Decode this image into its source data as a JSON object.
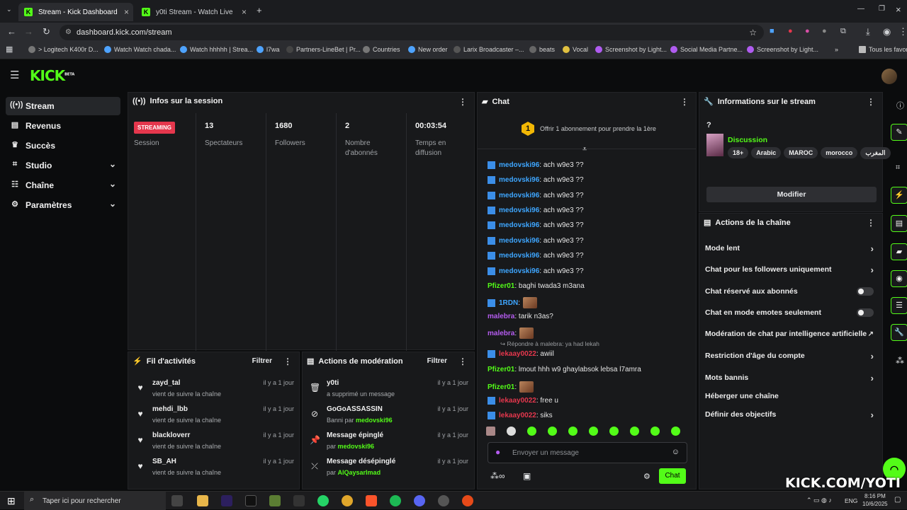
{
  "browser": {
    "tabs": [
      {
        "label": "Stream - Kick Dashboard"
      },
      {
        "label": "y0ti Stream - Watch Live on Kick"
      }
    ],
    "url": "dashboard.kick.com/stream",
    "bookmarks": [
      "> Logitech K400r D...",
      "Watch Watch chada...",
      "Watch hhhhh | Strea...",
      "l7wa",
      "Partners-LineBet | Pr...",
      "Countries",
      "New order",
      "Larix Broadcaster –...",
      "beats",
      "Vocal",
      "Screenshot by Light...",
      "Social Media Partne...",
      "Screenshot by Light...",
      "Tous les favoris"
    ]
  },
  "app": {
    "logo": "KICK",
    "logo_beta": "BETA"
  },
  "sidebar": {
    "items": [
      {
        "label": "Stream",
        "icon": "radio-icon"
      },
      {
        "label": "Revenus",
        "icon": "chart-icon"
      },
      {
        "label": "Succès",
        "icon": "trophy-icon"
      },
      {
        "label": "Studio",
        "icon": "studio-icon"
      },
      {
        "label": "Chaîne",
        "icon": "channel-icon"
      },
      {
        "label": "Paramètres",
        "icon": "gear-icon"
      }
    ]
  },
  "session": {
    "title": "Infos sur la session",
    "badge": "STREAMING",
    "session_label": "Session",
    "stats": [
      {
        "value": "13",
        "label": "Spectateurs"
      },
      {
        "value": "1680",
        "label": "Followers"
      },
      {
        "value": "2",
        "label": "Nombre d'abonnés"
      },
      {
        "value": "00:03:54",
        "label": "Temps en diffusion"
      }
    ]
  },
  "feed": {
    "title": "Fil d'activités",
    "filter": "Filtrer",
    "items": [
      {
        "name": "zayd_tal",
        "sub": "vient de suivre la chaîne",
        "time": "il y a 1 jour"
      },
      {
        "name": "mehdi_lbb",
        "sub": "vient de suivre la chaîne",
        "time": "il y a 1 jour"
      },
      {
        "name": "blackloverr",
        "sub": "vient de suivre la chaîne",
        "time": "il y a 1 jour"
      },
      {
        "name": "SB_AH",
        "sub": "vient de suivre la chaîne",
        "time": "il y a 1 jour"
      }
    ]
  },
  "modactions": {
    "title": "Actions de modération",
    "filter": "Filtrer",
    "items": [
      {
        "name": "y0ti",
        "sub": "a supprimé un message",
        "target": "",
        "time": "il y a 1 jour",
        "icon": "trash-icon"
      },
      {
        "name": "GoGoASSASSIN",
        "sub": "Banni par",
        "target": "medovski96",
        "time": "il y a 1 jour",
        "icon": "ban-icon"
      },
      {
        "name": "Message épinglé",
        "sub": "par",
        "target": "medovski96",
        "time": "il y a 1 jour",
        "icon": "pin-icon"
      },
      {
        "name": "Message désépinglé",
        "sub": "par",
        "target": "AlQaysarImad",
        "time": "il y a 1 jour",
        "icon": "unpin-icon"
      }
    ]
  },
  "chat": {
    "title": "Chat",
    "promo": "Offrir 1 abonnement pour prendre la 1ère",
    "promo_count": "1",
    "reply_hint": "Répondre à malebra: ya had lekah",
    "messages": [
      {
        "user": "medovski96",
        "text": ": ach w9e3 ??",
        "color": "#3ea6ff",
        "bot": true
      },
      {
        "user": "medovski96",
        "text": ": ach w9e3 ??",
        "color": "#3ea6ff",
        "bot": true
      },
      {
        "user": "medovski96",
        "text": ": ach w9e3 ??",
        "color": "#3ea6ff",
        "bot": true
      },
      {
        "user": "medovski96",
        "text": ": ach w9e3 ??",
        "color": "#3ea6ff",
        "bot": true
      },
      {
        "user": "medovski96",
        "text": ": ach w9e3 ??",
        "color": "#3ea6ff",
        "bot": true
      },
      {
        "user": "medovski96",
        "text": ": ach w9e3 ??",
        "color": "#3ea6ff",
        "bot": true
      },
      {
        "user": "medovski96",
        "text": ": ach w9e3 ??",
        "color": "#3ea6ff",
        "bot": true
      },
      {
        "user": "medovski96",
        "text": ": ach w9e3 ??",
        "color": "#3ea6ff",
        "bot": true
      },
      {
        "user": "Pfizer01",
        "text": ": baghi twada3 m3ana",
        "color": "#53fc18",
        "bot": false
      },
      {
        "user": "1RDN",
        "text": ":",
        "color": "#3ea6ff",
        "bot": true,
        "emote": true
      },
      {
        "user": "malebra",
        "text": ": tarik n3as?",
        "color": "#b55cf0",
        "bot": false
      },
      {
        "user": "malebra",
        "text": ":",
        "color": "#b55cf0",
        "bot": false,
        "emote": true
      },
      {
        "user": "lekaay0022",
        "text": ": awiil",
        "color": "#e5374d",
        "bot": true
      },
      {
        "user": "Pfizer01",
        "text": ": lmout hhh w9 ghaylabsok lebsa l7amra",
        "color": "#53fc18",
        "bot": false
      },
      {
        "user": "Pfizer01",
        "text": ":",
        "color": "#53fc18",
        "bot": false,
        "emote": true
      },
      {
        "user": "lekaay0022",
        "text": ": freе u",
        "color": "#e5374d",
        "bot": true
      },
      {
        "user": "lekaay0022",
        "text": ": siks",
        "color": "#e5374d",
        "bot": true
      }
    ],
    "input_placeholder": "Envoyer un message",
    "send_label": "Chat"
  },
  "streaminfo": {
    "title": "Informations sur le stream",
    "question": "?",
    "category": "Discussion",
    "tags": [
      "18+",
      "Arabic",
      "MAROC",
      "morocco",
      "المغرب"
    ],
    "edit_label": "Modifier"
  },
  "channelactions": {
    "title": "Actions de la chaîne",
    "items": [
      {
        "label": "Mode lent",
        "control": "arrow"
      },
      {
        "label": "Chat pour les followers uniquement",
        "control": "arrow"
      },
      {
        "label": "Chat réservé aux abonnés",
        "control": "toggle"
      },
      {
        "label": "Chat en mode emotes seulement",
        "control": "toggle"
      },
      {
        "label": "Modération de chat par intelligence artificielle",
        "control": "external"
      },
      {
        "label": "Restriction d'âge du compte",
        "control": "arrow"
      },
      {
        "label": "Mots bannis",
        "control": "arrow"
      },
      {
        "label": "Héberger une chaîne",
        "control": "none"
      },
      {
        "label": "Définir des objectifs",
        "control": "arrow"
      }
    ]
  },
  "watermark": "KICK.COM/YOTI",
  "taskbar": {
    "search": "Taper ici pour rechercher",
    "lang": "ENG",
    "time": "8:16 PM",
    "date": "10/6/2025"
  },
  "colors": {
    "brand": "#53fc18",
    "live": "#e5374d",
    "panel": "#18191b",
    "bg": "#0b0c0d"
  }
}
